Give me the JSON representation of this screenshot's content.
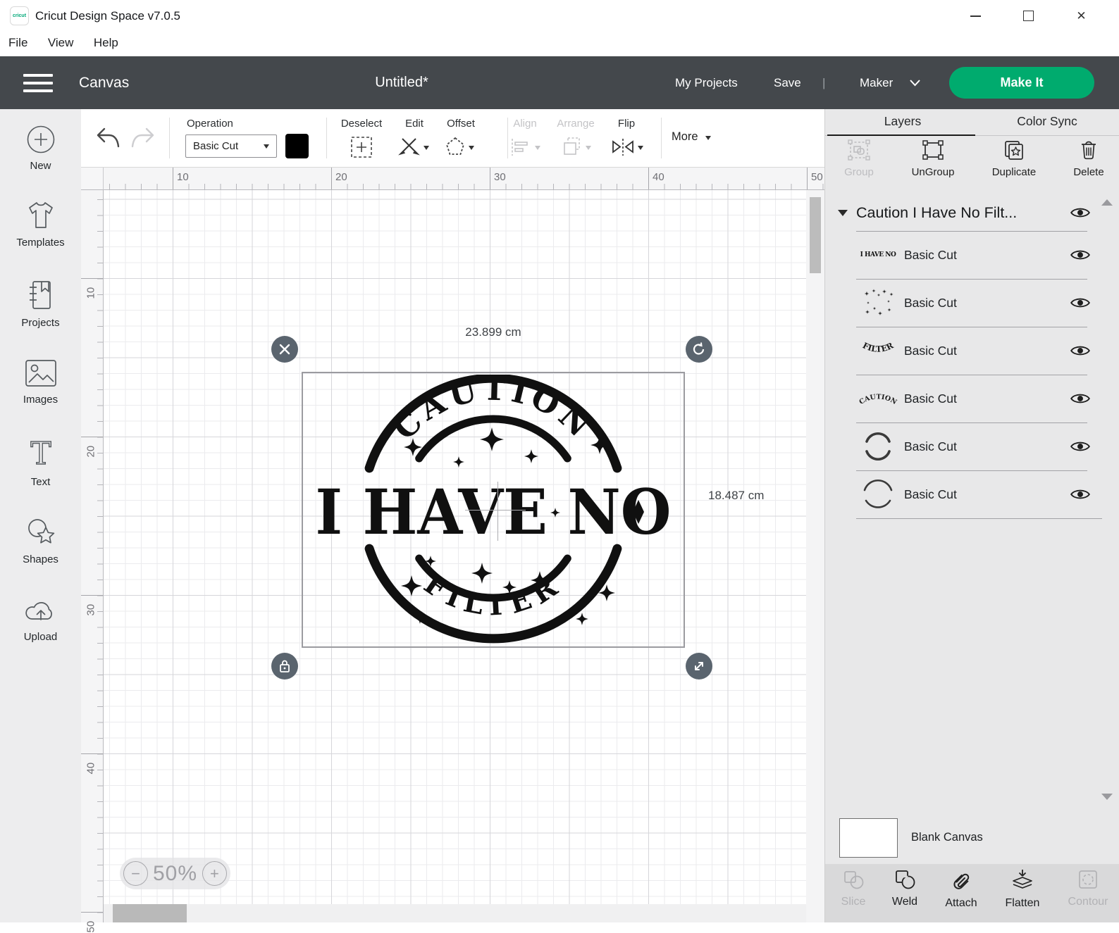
{
  "window": {
    "logo_text": "cricut",
    "title": "Cricut Design Space  v7.0.5",
    "menu": [
      "File",
      "View",
      "Help"
    ]
  },
  "header": {
    "page_label": "Canvas",
    "doc_title": "Untitled*",
    "my_projects": "My Projects",
    "save": "Save",
    "separator": "|",
    "machine": "Maker",
    "make_it": "Make It"
  },
  "toolbar": {
    "operation_label": "Operation",
    "operation_value": "Basic Cut",
    "deselect": "Deselect",
    "edit": "Edit",
    "offset": "Offset",
    "align": "Align",
    "arrange": "Arrange",
    "flip": "Flip",
    "more": "More"
  },
  "sidebar": {
    "items": [
      {
        "label": "New",
        "icon": "plus-circle-icon"
      },
      {
        "label": "Templates",
        "icon": "tshirt-icon"
      },
      {
        "label": "Projects",
        "icon": "notebook-icon"
      },
      {
        "label": "Images",
        "icon": "image-icon"
      },
      {
        "label": "Text",
        "icon": "text-icon"
      },
      {
        "label": "Shapes",
        "icon": "shapes-icon"
      },
      {
        "label": "Upload",
        "icon": "upload-cloud-icon"
      }
    ]
  },
  "canvas": {
    "ruler_x": [
      "10",
      "20",
      "30",
      "40",
      "50"
    ],
    "ruler_y": [
      "10",
      "20",
      "30",
      "40",
      "50"
    ],
    "zoom_minus": "−",
    "zoom_percent": "50%",
    "zoom_plus": "+",
    "selection": {
      "width": "23.899 cm",
      "height": "18.487 cm"
    },
    "design": {
      "top": "CAUTION",
      "middle": "I HAVE NO",
      "bottom": "FILTER"
    }
  },
  "layers_panel": {
    "tabs": [
      {
        "label": "Layers",
        "active": true
      },
      {
        "label": "Color Sync",
        "active": false
      }
    ],
    "actions": [
      {
        "label": "Group",
        "enabled": false
      },
      {
        "label": "UnGroup",
        "enabled": true
      },
      {
        "label": "Duplicate",
        "enabled": true
      },
      {
        "label": "Delete",
        "enabled": true
      }
    ],
    "group_header": "Caution I Have No Filt...",
    "layers": [
      {
        "name": "Basic Cut",
        "thumb": "i-have-no",
        "thumb_text": "I HAVE NO"
      },
      {
        "name": "Basic Cut",
        "thumb": "sparkles",
        "thumb_text": ""
      },
      {
        "name": "Basic Cut",
        "thumb": "filter",
        "thumb_text": "FILTER"
      },
      {
        "name": "Basic Cut",
        "thumb": "caution",
        "thumb_text": "CAUTION"
      },
      {
        "name": "Basic Cut",
        "thumb": "arcs",
        "thumb_text": ""
      },
      {
        "name": "Basic Cut",
        "thumb": "circle-arcs",
        "thumb_text": ""
      }
    ],
    "blank_canvas": "Blank Canvas",
    "bottom_actions": [
      {
        "label": "Slice",
        "enabled": false
      },
      {
        "label": "Weld",
        "enabled": true
      },
      {
        "label": "Attach",
        "enabled": true
      },
      {
        "label": "Flatten",
        "enabled": true
      },
      {
        "label": "Contour",
        "enabled": false
      }
    ]
  },
  "colors": {
    "accent_green": "#00ab6e",
    "header_dark": "#44484c",
    "operation_swatch": "#000000",
    "handle_gray": "#5a646e"
  }
}
